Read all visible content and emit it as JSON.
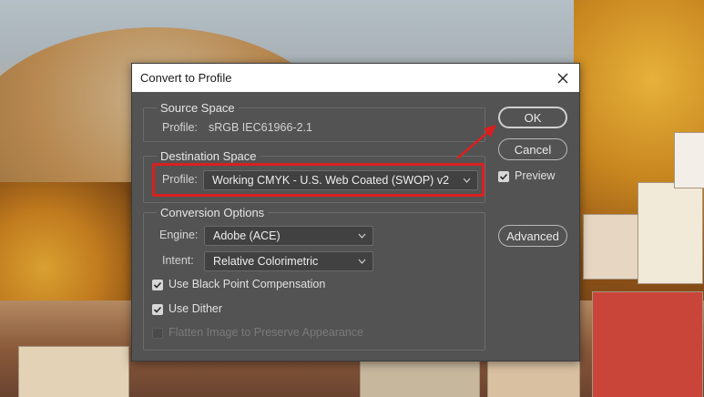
{
  "dialog": {
    "title": "Convert to Profile",
    "close_icon": "close-icon"
  },
  "source_space": {
    "heading": "Source Space",
    "profile_label": "Profile:",
    "profile_value": "sRGB IEC61966-2.1"
  },
  "destination_space": {
    "heading": "Destination Space",
    "profile_label": "Profile:",
    "profile_selected": "Working CMYK - U.S. Web Coated (SWOP) v2"
  },
  "conversion_options": {
    "heading": "Conversion Options",
    "engine_label": "Engine:",
    "engine_selected": "Adobe (ACE)",
    "intent_label": "Intent:",
    "intent_selected": "Relative Colorimetric",
    "black_point": {
      "label": "Use Black Point Compensation",
      "checked": true
    },
    "dither": {
      "label": "Use Dither",
      "checked": true
    },
    "flatten": {
      "label": "Flatten Image to Preserve Appearance",
      "checked": false,
      "enabled": false
    }
  },
  "buttons": {
    "ok": "OK",
    "cancel": "Cancel",
    "advanced": "Advanced"
  },
  "preview": {
    "label": "Preview",
    "checked": true
  },
  "colors": {
    "dialog_bg": "#535353",
    "highlight": "#d9201f"
  }
}
